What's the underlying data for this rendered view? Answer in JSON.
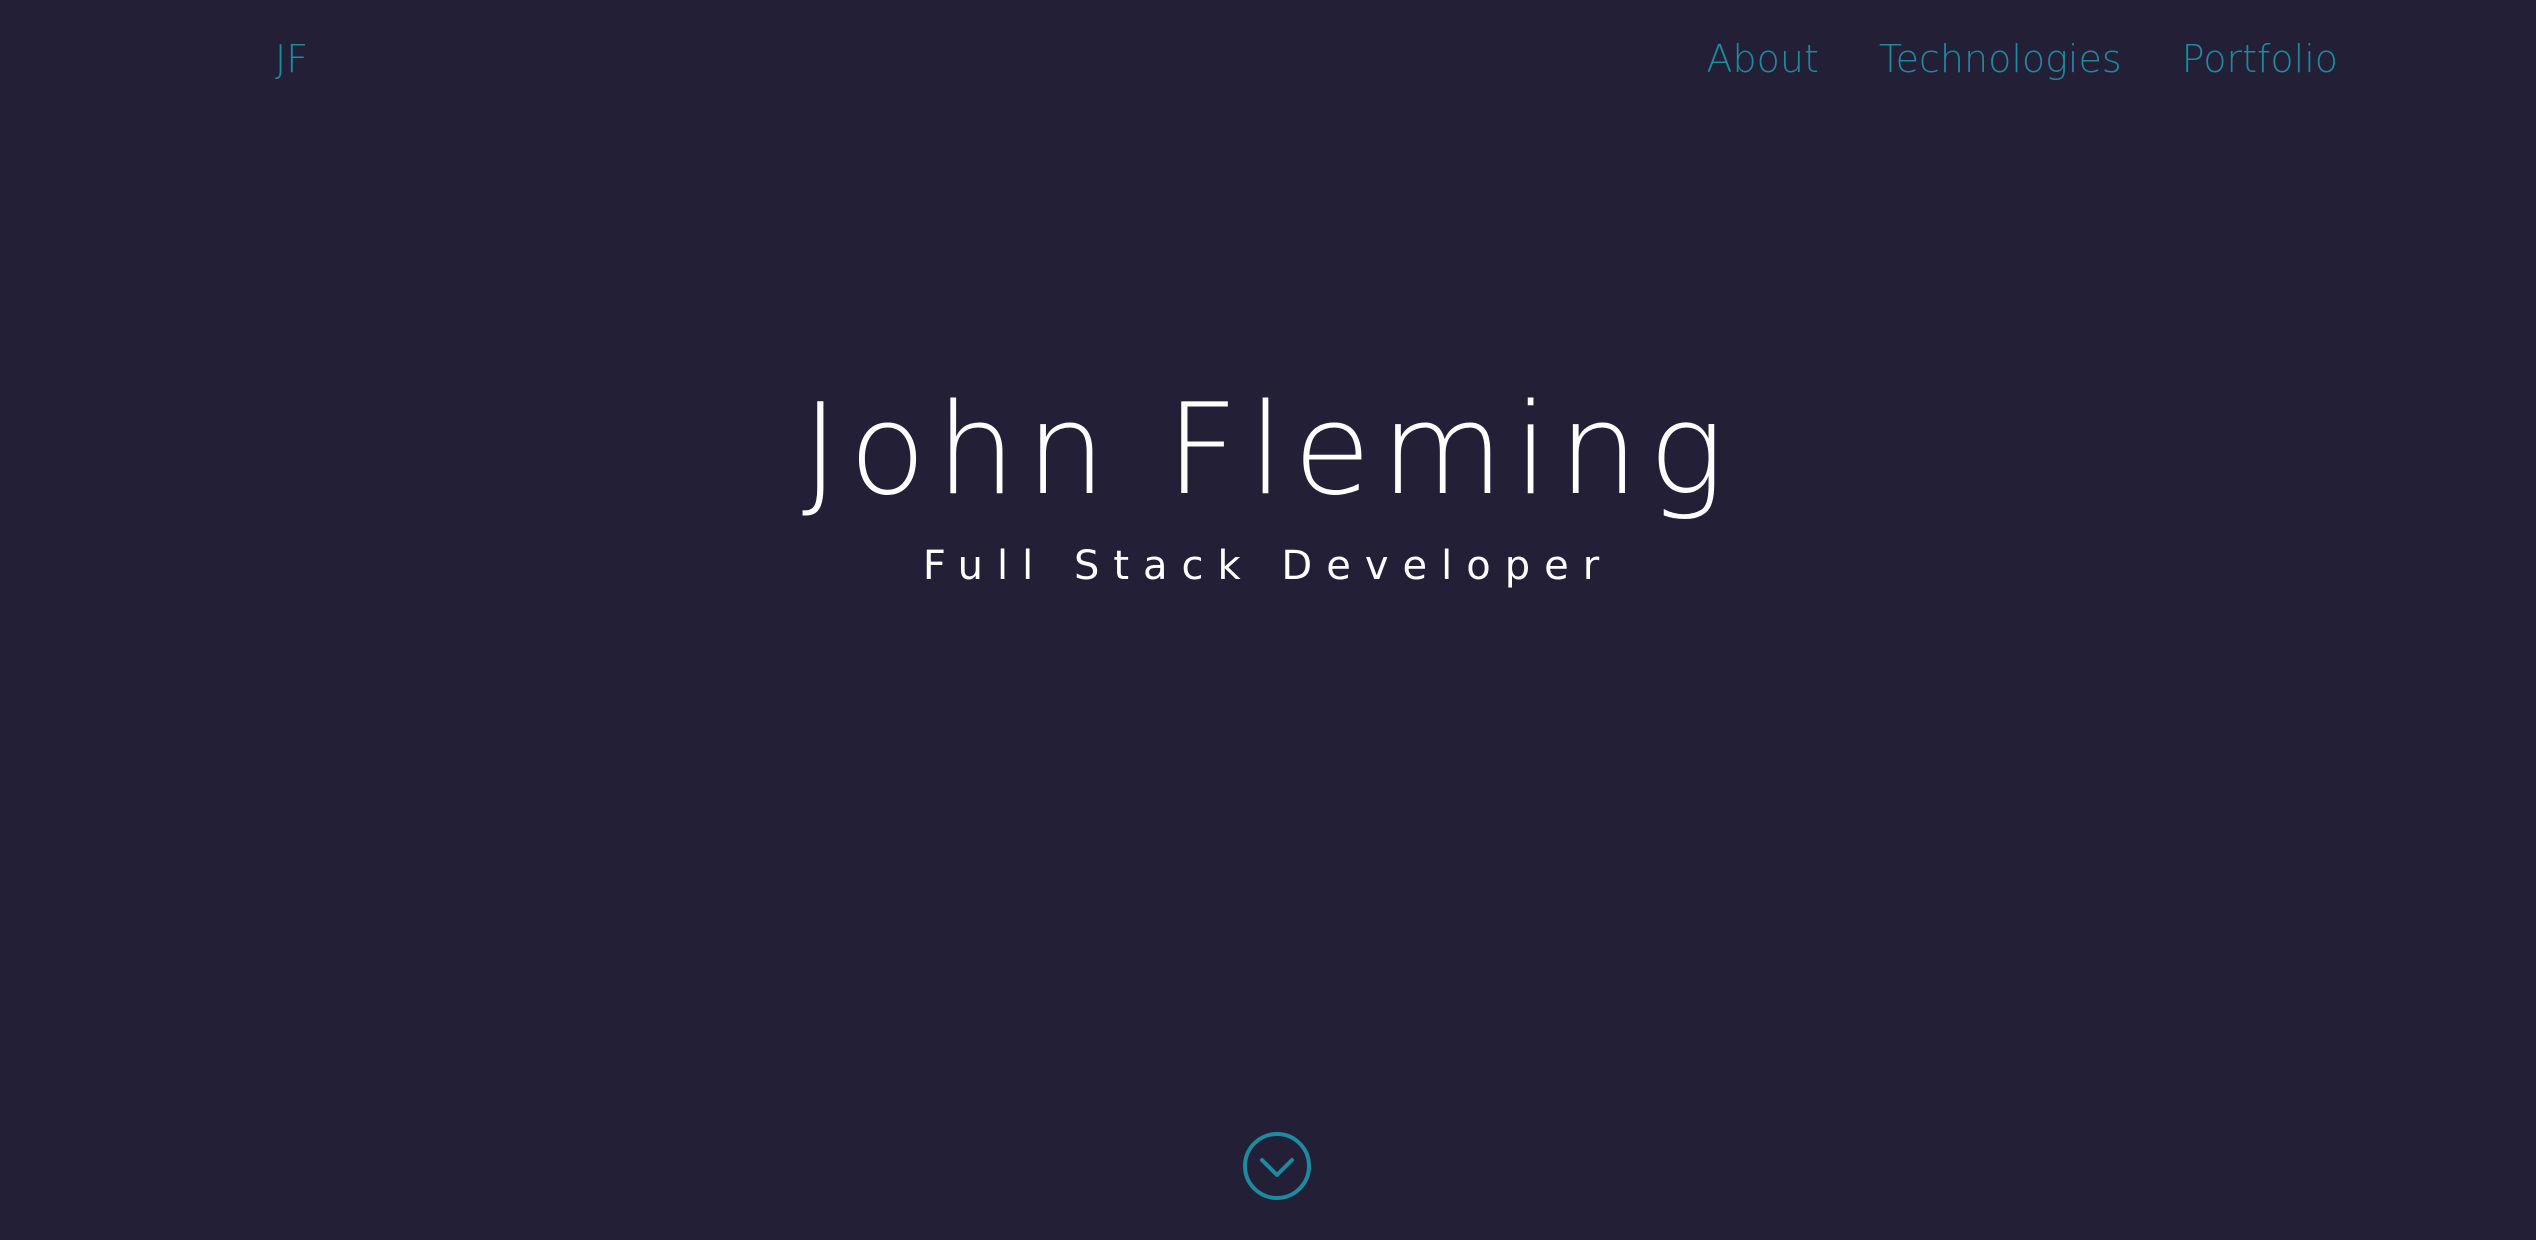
{
  "header": {
    "logo": "JF",
    "nav": [
      {
        "label": "About"
      },
      {
        "label": "Technologies"
      },
      {
        "label": "Portfolio"
      }
    ]
  },
  "hero": {
    "name": "John Fleming",
    "subtitle": "Full Stack Developer"
  },
  "scroll_button": {
    "icon": "chevron-down-circle-icon"
  },
  "colors": {
    "background": "#231f37",
    "accent": "#1e8aa0",
    "text": "#ffffff"
  }
}
